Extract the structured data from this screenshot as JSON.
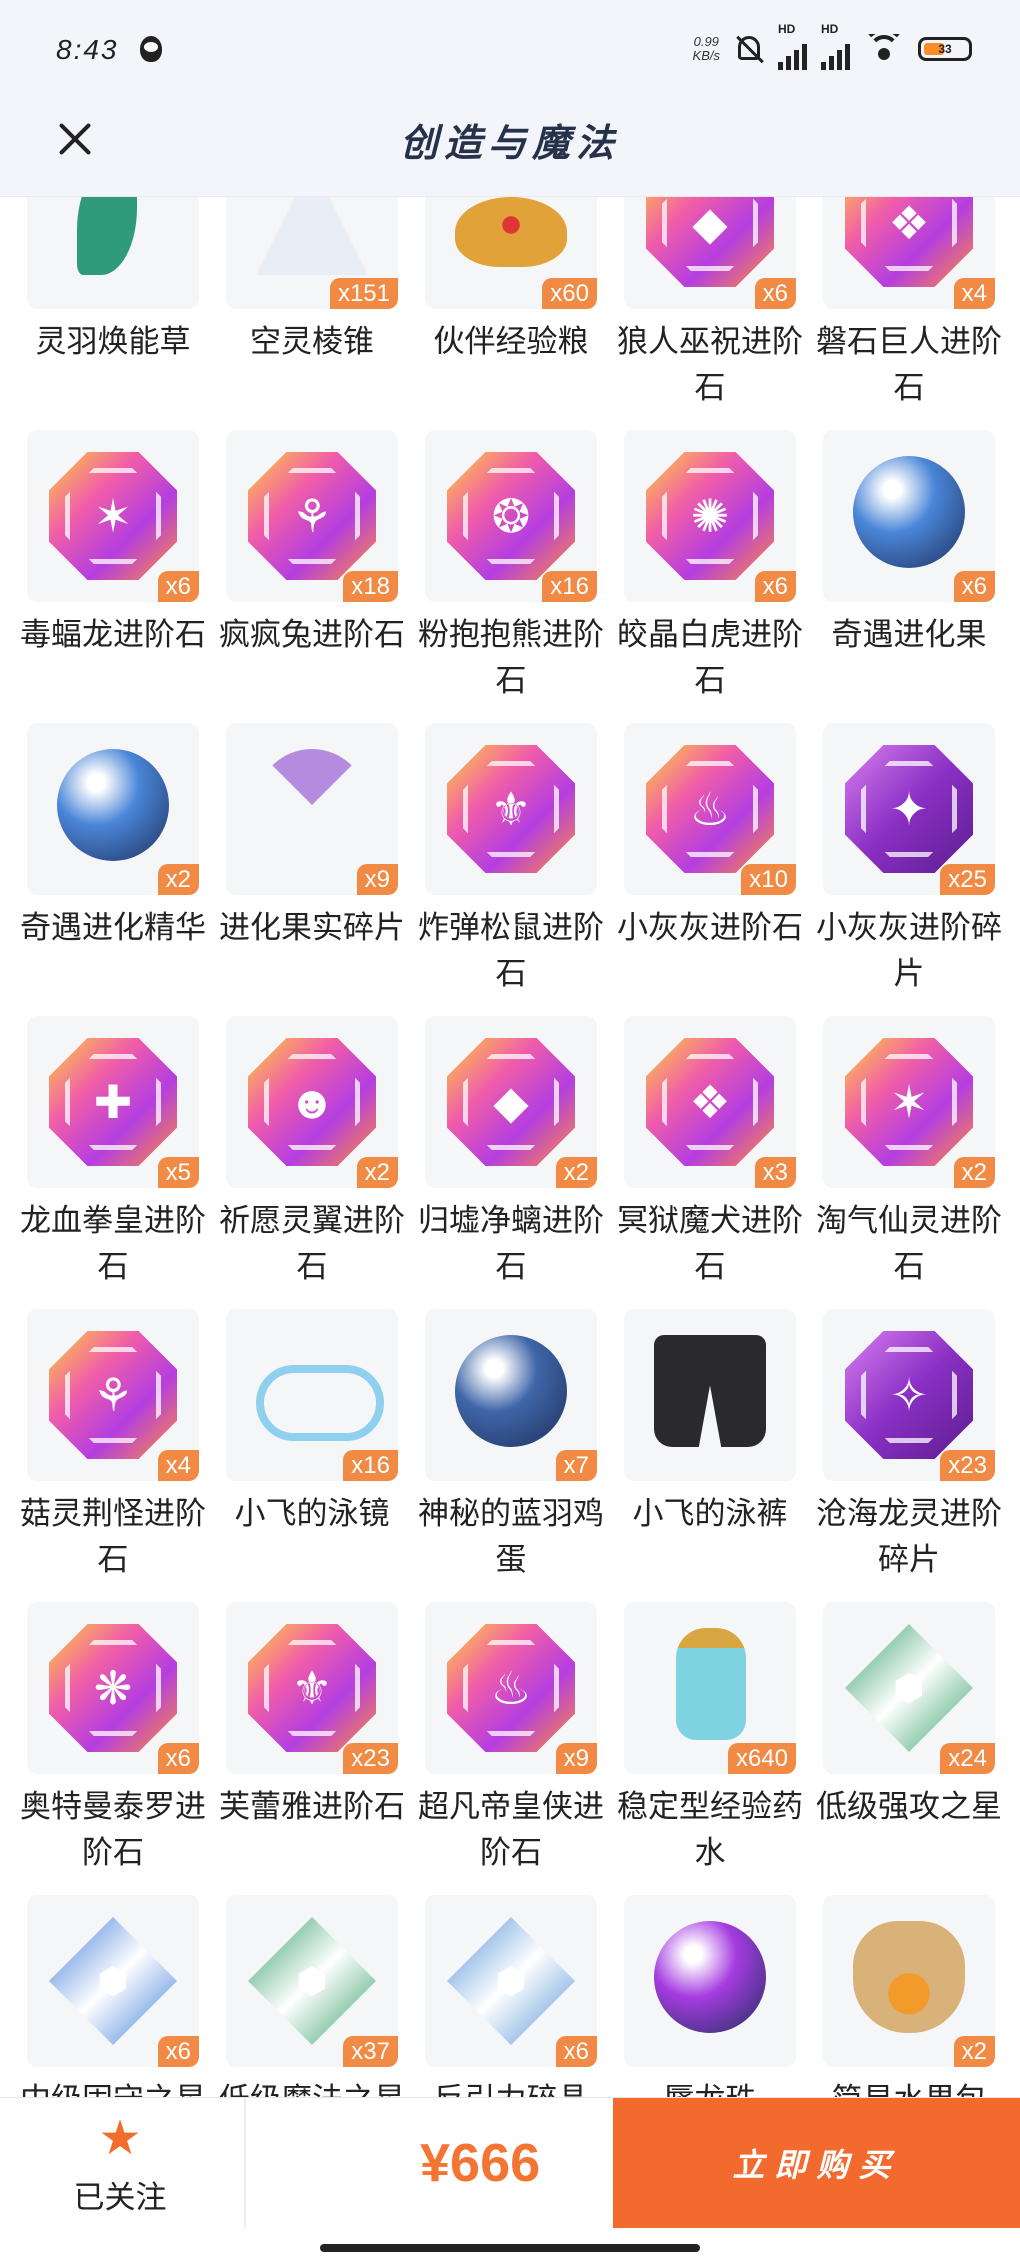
{
  "status_bar": {
    "time": "8:43",
    "net_speed_value": "0.99",
    "net_speed_unit": "KB/s",
    "hd_1": "HD",
    "hd_2": "HD",
    "battery": "33"
  },
  "header": {
    "title": "创造与魔法"
  },
  "items": [
    {
      "label": "灵羽焕能草",
      "count": "",
      "icon": "green-herb",
      "color": "#2f9b7a"
    },
    {
      "label": "空灵棱锥",
      "count": "x151",
      "icon": "white-pyramid",
      "color": "#e9edf5"
    },
    {
      "label": "伙伴经验粮",
      "count": "x60",
      "icon": "pet-food",
      "color": "#e2a23a"
    },
    {
      "label": "狼人巫祝进阶石",
      "count": "x6",
      "icon": "evolution-stone",
      "color": "#c93fd0"
    },
    {
      "label": "磐石巨人进阶石",
      "count": "x4",
      "icon": "evolution-stone",
      "color": "#c93fd0"
    },
    {
      "label": "毒蝠龙进阶石",
      "count": "x6",
      "icon": "evolution-stone",
      "color": "#c93fd0"
    },
    {
      "label": "疯疯兔进阶石",
      "count": "x18",
      "icon": "evolution-stone",
      "color": "#c93fd0"
    },
    {
      "label": "粉抱抱熊进阶石",
      "count": "x16",
      "icon": "evolution-stone",
      "color": "#c93fd0"
    },
    {
      "label": "皎晶白虎进阶石",
      "count": "x6",
      "icon": "evolution-stone",
      "color": "#c93fd0"
    },
    {
      "label": "奇遇进化果",
      "count": "x6",
      "icon": "blue-berry",
      "color": "#4a86d8"
    },
    {
      "label": "奇遇进化精华",
      "count": "x2",
      "icon": "blue-berry-essence",
      "color": "#4a86d8"
    },
    {
      "label": "进化果实碎片",
      "count": "x9",
      "icon": "fruit-slice",
      "color": "#b58be0"
    },
    {
      "label": "炸弹松鼠进阶石",
      "count": "",
      "icon": "evolution-stone",
      "color": "#c93fd0"
    },
    {
      "label": "小灰灰进阶石",
      "count": "x10",
      "icon": "evolution-stone",
      "color": "#c93fd0"
    },
    {
      "label": "小灰灰进阶碎片",
      "count": "x25",
      "icon": "evolution-shard",
      "color": "#8a32c9"
    },
    {
      "label": "龙血拳皇进阶石",
      "count": "x5",
      "icon": "evolution-stone",
      "color": "#c93fd0"
    },
    {
      "label": "祈愿灵翼进阶石",
      "count": "x2",
      "icon": "evolution-stone",
      "color": "#c93fd0"
    },
    {
      "label": "归墟净螭进阶石",
      "count": "x2",
      "icon": "evolution-stone",
      "color": "#c93fd0"
    },
    {
      "label": "冥狱魔犬进阶石",
      "count": "x3",
      "icon": "evolution-stone",
      "color": "#c93fd0"
    },
    {
      "label": "淘气仙灵进阶石",
      "count": "x2",
      "icon": "evolution-stone",
      "color": "#c93fd0"
    },
    {
      "label": "菇灵荆怪进阶石",
      "count": "x4",
      "icon": "evolution-stone",
      "color": "#c93fd0"
    },
    {
      "label": "小飞的泳镜",
      "count": "x16",
      "icon": "swim-goggles",
      "color": "#8fd0ee"
    },
    {
      "label": "神秘的蓝羽鸡蛋",
      "count": "x7",
      "icon": "blue-egg",
      "color": "#3f66a8"
    },
    {
      "label": "小飞的泳裤",
      "count": "",
      "icon": "swim-trunks",
      "color": "#2a2a2e"
    },
    {
      "label": "沧海龙灵进阶碎片",
      "count": "x23",
      "icon": "evolution-shard",
      "color": "#8a32c9"
    },
    {
      "label": "奥特曼泰罗进阶石",
      "count": "x6",
      "icon": "evolution-stone",
      "color": "#c93fd0"
    },
    {
      "label": "芙蕾雅进阶石",
      "count": "x23",
      "icon": "evolution-stone",
      "color": "#c93fd0"
    },
    {
      "label": "超凡帝皇侠进阶石",
      "count": "x9",
      "icon": "evolution-stone",
      "color": "#c93fd0"
    },
    {
      "label": "稳定型经验药水",
      "count": "x640",
      "icon": "potion",
      "color": "#7fd3e0"
    },
    {
      "label": "低级强攻之星",
      "count": "x24",
      "icon": "green-crystal",
      "color": "#2e9c62"
    },
    {
      "label": "中级固守之星",
      "count": "x6",
      "icon": "blue-crystal",
      "color": "#3877d9"
    },
    {
      "label": "低级魔法之星",
      "count": "x37",
      "icon": "green-crystal",
      "color": "#2e9c62"
    },
    {
      "label": "反引力碎晶",
      "count": "x6",
      "icon": "anti-gravity-crystal",
      "color": "#4d8fd6"
    },
    {
      "label": "蜃龙珠",
      "count": "",
      "icon": "purple-orb",
      "color": "#a53ce0"
    },
    {
      "label": "简易水果包",
      "count": "x2",
      "icon": "fruit-bag",
      "color": "#d9b27a"
    }
  ],
  "bottom_bar": {
    "follow_label": "已关注",
    "price": "¥666",
    "buy_label": "立即购买",
    "accent": "#f36a2e"
  }
}
